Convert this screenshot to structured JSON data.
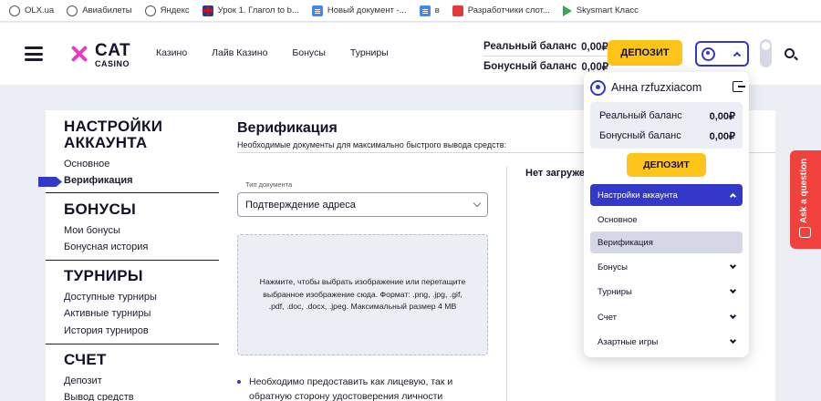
{
  "bookmarks": [
    {
      "label": "OLX.ua",
      "icon": "globe-icon"
    },
    {
      "label": "Авиабилеты",
      "icon": "globe-icon"
    },
    {
      "label": "Яндекс",
      "icon": "globe-icon"
    },
    {
      "label": "Урок 1. Глагол to b...",
      "icon": "uk-flag-icon"
    },
    {
      "label": "Новый документ -...",
      "icon": "docs-icon"
    },
    {
      "label": "в",
      "icon": "docs-icon"
    },
    {
      "label": "Разработчики слот...",
      "icon": "red-s-icon"
    },
    {
      "label": "Skysmart Класс",
      "icon": "play-icon"
    }
  ],
  "header": {
    "logo_word": "CAT",
    "logo_sub": "CASINO",
    "nav": [
      "Казино",
      "Лайв Казино",
      "Бонусы",
      "Турниры"
    ],
    "real_balance_label": "Реальный баланс",
    "real_balance_value": "0,00₽",
    "bonus_balance_label": "Бонусный баланс",
    "bonus_balance_value": "0,00₽",
    "deposit_label": "ДЕПОЗИТ"
  },
  "sidebar": {
    "account_title": "НАСТРОЙКИ АККАУНТА",
    "account_items": [
      "Основное",
      "Верификация"
    ],
    "bonuses_title": "БОНУСЫ",
    "bonuses_items": [
      "Мои бонусы",
      "Бонусная история"
    ],
    "tournaments_title": "ТУРНИРЫ",
    "tournaments_items": [
      "Доступные турниры",
      "Активные турниры",
      "История турниров"
    ],
    "account2_title": "СЧЕТ",
    "account2_items": [
      "Депозит",
      "Вывод средств"
    ]
  },
  "content": {
    "title": "Верификация",
    "subtitle": "Необходимые документы для максимально быстрого вывода средств:",
    "doctype_label": "Тип документа",
    "doctype_value": "Подтверждение адреса",
    "dropzone_text": "Нажмите, чтобы выбрать изображение или перетащите выбранное изображение сюда. Формат: .png, .jpg, .gif, .pdf, .doc, .docx, .jpeg. Максимальный размер 4 MB",
    "bullet_text": "Необходимо предоставить как лицевую, так и обратную сторону удостоверения личности",
    "no_files": "Нет загружен"
  },
  "ask": {
    "label": "Ask a question"
  },
  "dropdown": {
    "username": "Анна rzfuzxiacom",
    "real_label": "Реальный баланс",
    "real_value": "0,00₽",
    "bonus_label": "Бонусный баланс",
    "bonus_value": "0,00₽",
    "deposit_label": "ДЕПОЗИТ",
    "menu": [
      {
        "label": "Настройки аккаунта"
      },
      {
        "label": "Основное"
      },
      {
        "label": "Верификация"
      },
      {
        "label": "Бонусы"
      },
      {
        "label": "Турниры"
      },
      {
        "label": "Счет"
      },
      {
        "label": "Азартные игры"
      }
    ]
  },
  "colors": {
    "accent": "#3438c8",
    "deposit": "#fec41a",
    "ask": "#f0413d",
    "background": "#eceef6"
  }
}
